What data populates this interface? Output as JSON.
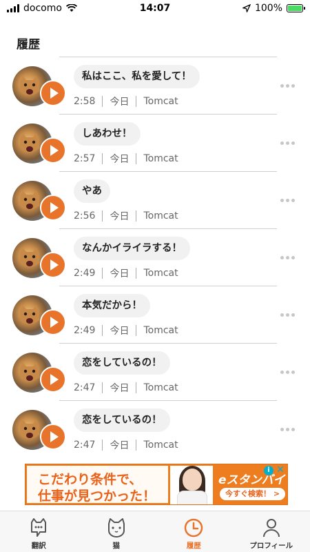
{
  "status_bar": {
    "carrier": "docomo",
    "time": "14:07",
    "battery": "100%",
    "battery_level": 1.0
  },
  "header": {
    "title": "履歴"
  },
  "history": [
    {
      "phrase": "私はここ、私を愛して！",
      "time": "2:58",
      "day": "今日",
      "name": "Tomcat"
    },
    {
      "phrase": "しあわせ！",
      "time": "2:57",
      "day": "今日",
      "name": "Tomcat"
    },
    {
      "phrase": "やあ",
      "time": "2:56",
      "day": "今日",
      "name": "Tomcat"
    },
    {
      "phrase": "なんかイライラする！",
      "time": "2:49",
      "day": "今日",
      "name": "Tomcat"
    },
    {
      "phrase": "本気だから！",
      "time": "2:49",
      "day": "今日",
      "name": "Tomcat"
    },
    {
      "phrase": "恋をしているの！",
      "time": "2:47",
      "day": "今日",
      "name": "Tomcat"
    },
    {
      "phrase": "恋をしているの！",
      "time": "2:47",
      "day": "今日",
      "name": "Tomcat"
    }
  ],
  "ad": {
    "line1": "こだわり条件で、",
    "line2": "仕事が見つかった！",
    "logo": "eスタンバイ",
    "cta": "今すぐ検索！ >",
    "info": "i",
    "close": "✕"
  },
  "tabs": [
    {
      "label": "翻訳",
      "icon": "cat-speech-icon",
      "active": false
    },
    {
      "label": "猫",
      "icon": "cat-face-icon",
      "active": false
    },
    {
      "label": "履歴",
      "icon": "clock-icon",
      "active": true
    },
    {
      "label": "プロフィール",
      "icon": "person-icon",
      "active": false
    }
  ],
  "colors": {
    "accent": "#e8742c",
    "bubble": "#f1f1f1",
    "tabbar": "#f7f7f7"
  }
}
